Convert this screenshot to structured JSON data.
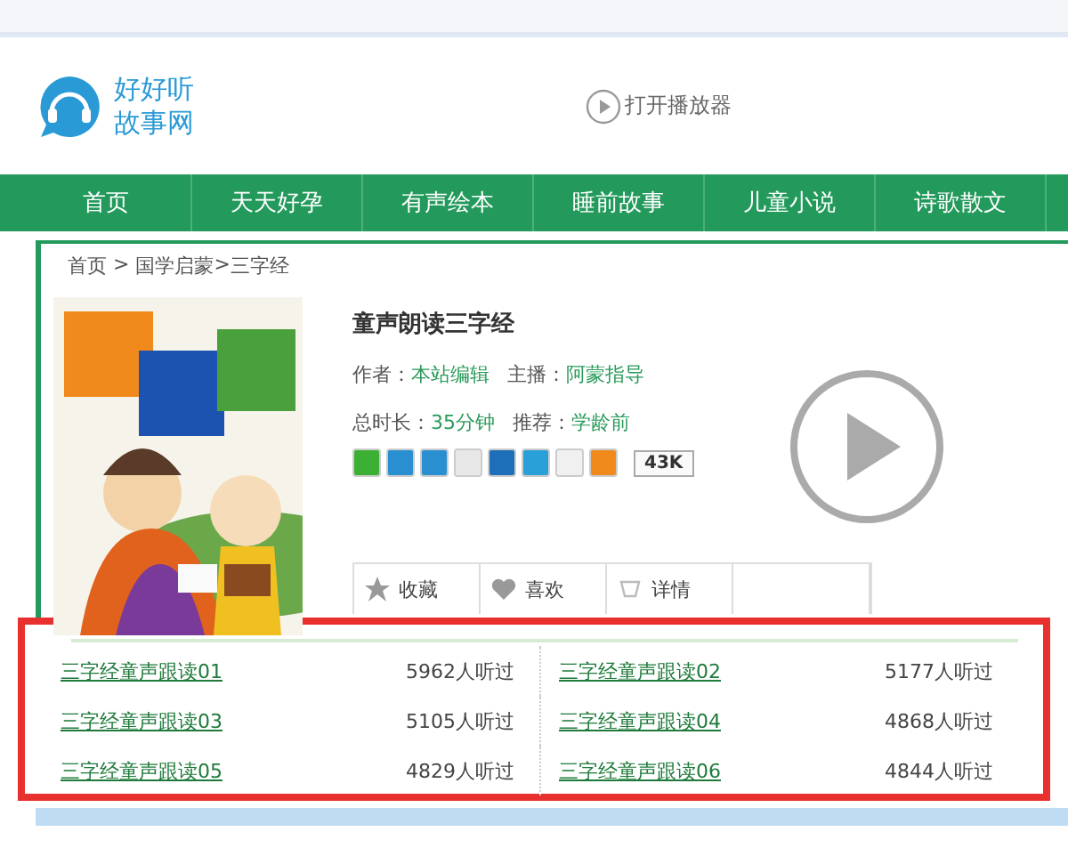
{
  "header": {
    "logo_lines": [
      "好好听",
      "故事网"
    ],
    "player_link": "打开播放器"
  },
  "nav": {
    "items": [
      "首页",
      "天天好孕",
      "有声绘本",
      "睡前故事",
      "儿童小说",
      "诗歌散文"
    ]
  },
  "breadcrumb": {
    "items": [
      "首页",
      "国学启蒙",
      "三字经"
    ],
    "separators": [
      " > ",
      ">"
    ]
  },
  "detail": {
    "title": "童声朗读三字经",
    "meta_rows": [
      [
        {
          "label": "作者：",
          "value": "本站编辑"
        },
        {
          "label": "主播：",
          "value": "阿蒙指导"
        }
      ],
      [
        {
          "label": "总时长：",
          "value": "35分钟"
        },
        {
          "label": "推荐：",
          "value": "学龄前"
        }
      ]
    ],
    "share": {
      "icons": [
        {
          "color": "#3cb034"
        },
        {
          "color": "#2a8fd0"
        },
        {
          "color": "#2a8fd0"
        },
        {
          "color": "#e8e8e8"
        },
        {
          "color": "#1c6fb8"
        },
        {
          "color": "#2aa0d8"
        },
        {
          "color": "#f0f0f0"
        },
        {
          "color": "#f08a1c"
        }
      ],
      "count": "43K"
    },
    "actions": [
      {
        "kind": "star",
        "label": "收藏"
      },
      {
        "kind": "heart",
        "label": "喜欢"
      },
      {
        "kind": "cup",
        "label": "详情"
      },
      {
        "kind": "blank"
      }
    ]
  },
  "episodes": [
    {
      "title": "三字经童声跟读01",
      "plays": "5962人听过"
    },
    {
      "title": "三字经童声跟读02",
      "plays": "5177人听过"
    },
    {
      "title": "三字经童声跟读03",
      "plays": "5105人听过"
    },
    {
      "title": "三字经童声跟读04",
      "plays": "4868人听过"
    },
    {
      "title": "三字经童声跟读05",
      "plays": "4829人听过"
    },
    {
      "title": "三字经童声跟读06",
      "plays": "4844人听过"
    }
  ]
}
